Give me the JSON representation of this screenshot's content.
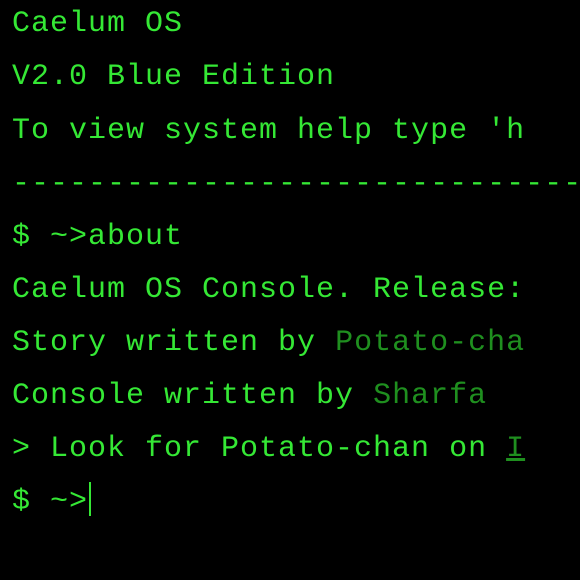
{
  "header": {
    "title": "Caelum OS",
    "version": "V2.0 Blue Edition",
    "help_hint": "To view system help type 'h",
    "divider": "---------------------------------"
  },
  "session": {
    "prompt": "$ ~>",
    "command": "about",
    "output": {
      "release_line": "Caelum OS Console. Release:",
      "story_prefix": "Story written by ",
      "story_author": "Potato-cha",
      "console_prefix": "Console written by ",
      "console_author": "Sharfa",
      "look_prefix": "> Look for Potato-chan on ",
      "look_link": "I"
    },
    "current_prompt": "$ ~>"
  },
  "colors": {
    "background": "#000000",
    "text": "#35e835",
    "dim_text": "#1f8f1f"
  }
}
